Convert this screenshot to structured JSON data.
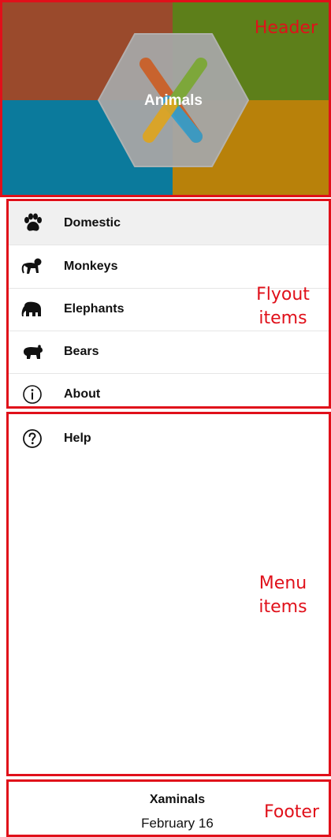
{
  "header": {
    "title": "Animals",
    "annotation": "Header",
    "colors": {
      "top_left": "#9a4a2c",
      "top_right": "#5d7f1a",
      "bottom_left": "#0b7a9c",
      "bottom_right": "#b8810a",
      "hexagon": "#a6a6a6"
    }
  },
  "flyout": {
    "annotation_line1": "Flyout",
    "annotation_line2": "items",
    "items": [
      {
        "label": "Domestic",
        "icon": "paw-icon",
        "selected": true
      },
      {
        "label": "Monkeys",
        "icon": "monkey-icon"
      },
      {
        "label": "Elephants",
        "icon": "elephant-icon"
      },
      {
        "label": "Bears",
        "icon": "bear-icon"
      },
      {
        "label": "About",
        "icon": "info-icon"
      }
    ]
  },
  "menu": {
    "annotation_line1": "Menu",
    "annotation_line2": "items",
    "items": [
      {
        "label": "Help",
        "icon": "question-icon"
      }
    ]
  },
  "footer": {
    "title": "Xaminals",
    "date": "February 16",
    "annotation": "Footer"
  },
  "annotation_color": "#e0101a"
}
